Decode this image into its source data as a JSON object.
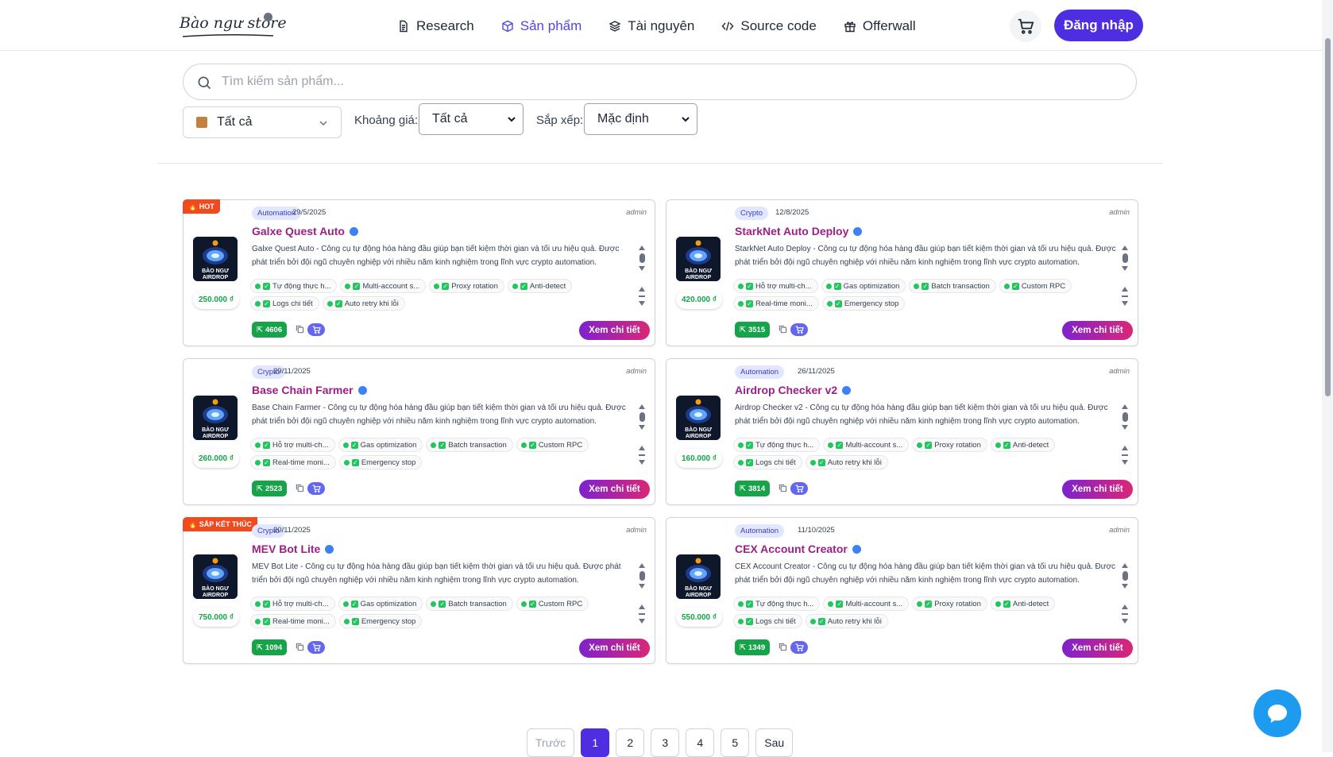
{
  "brand": {
    "logo_text": "Bào ngư store"
  },
  "nav": {
    "items": [
      {
        "label": "Research",
        "icon": "document-icon"
      },
      {
        "label": "Sản phẩm",
        "icon": "cube-icon",
        "active": true
      },
      {
        "label": "Tài nguyên",
        "icon": "layers-icon"
      },
      {
        "label": "Source code",
        "icon": "code-icon"
      },
      {
        "label": "Offerwall",
        "icon": "gift-icon"
      }
    ],
    "login_label": "Đăng nhập"
  },
  "search": {
    "placeholder": "Tìm kiếm sản phẩm..."
  },
  "filters": {
    "category_value": "Tất cả",
    "price_label": "Khoảng giá:",
    "price_value": "Tất cả",
    "sort_label": "Sắp xếp:",
    "sort_value": "Mặc định"
  },
  "products": [
    {
      "ribbon": "HOT",
      "category": "Automation",
      "date": "29/5/2025",
      "author": "admin",
      "title": "Galxe Quest Auto",
      "description": "Galxe Quest Auto - Công cụ tự động hóa hàng đầu giúp bạn tiết kiệm thời gian và tối ưu hiệu quả. Được phát triển bởi đội ngũ chuyên nghiệp với nhiều năm kinh nghiệm trong lĩnh vực crypto automation.",
      "price": "250.000 ₫",
      "features": [
        "Tự động thực h...",
        "Multi-account s...",
        "Proxy rotation",
        "Anti-detect",
        "Logs chi tiết",
        "Auto retry khi lỗi"
      ],
      "views": "4606",
      "detail_label": "Xem chi tiết"
    },
    {
      "ribbon": "",
      "category": "Crypto",
      "date": "12/8/2025",
      "author": "admin",
      "title": "StarkNet Auto Deploy",
      "description": "StarkNet Auto Deploy - Công cụ tự động hóa hàng đầu giúp bạn tiết kiệm thời gian và tối ưu hiệu quả. Được phát triển bởi đội ngũ chuyên nghiệp với nhiều năm kinh nghiệm trong lĩnh vực crypto automation.",
      "price": "420.000 ₫",
      "features": [
        "Hỗ trợ multi-ch...",
        "Gas optimization",
        "Batch transaction",
        "Custom RPC",
        "Real-time moni...",
        "Emergency stop"
      ],
      "views": "3515",
      "detail_label": "Xem chi tiết"
    },
    {
      "ribbon": "",
      "category": "Crypto",
      "date": "29/11/2025",
      "author": "admin",
      "title": "Base Chain Farmer",
      "description": "Base Chain Farmer - Công cụ tự động hóa hàng đầu giúp bạn tiết kiệm thời gian và tối ưu hiệu quả. Được phát triển bởi đội ngũ chuyên nghiệp với nhiều năm kinh nghiệm trong lĩnh vực crypto automation.",
      "price": "260.000 ₫",
      "features": [
        "Hỗ trợ multi-ch...",
        "Gas optimization",
        "Batch transaction",
        "Custom RPC",
        "Real-time moni...",
        "Emergency stop"
      ],
      "views": "2523",
      "detail_label": "Xem chi tiết"
    },
    {
      "ribbon": "",
      "category": "Automation",
      "date": "26/11/2025",
      "author": "admin",
      "title": "Airdrop Checker v2",
      "description": "Airdrop Checker v2 - Công cụ tự động hóa hàng đầu giúp bạn tiết kiệm thời gian và tối ưu hiệu quả. Được phát triển bởi đội ngũ chuyên nghiệp với nhiều năm kinh nghiệm trong lĩnh vực crypto automation.",
      "price": "160.000 ₫",
      "features": [
        "Tự động thực h...",
        "Multi-account s...",
        "Proxy rotation",
        "Anti-detect",
        "Logs chi tiết",
        "Auto retry khi lỗi"
      ],
      "views": "3814",
      "detail_label": "Xem chi tiết"
    },
    {
      "ribbon": "SẮP KẾT THÚC",
      "category": "Crypto",
      "date": "20/11/2025",
      "author": "admin",
      "title": "MEV Bot Lite",
      "description": "MEV Bot Lite - Công cụ tự động hóa hàng đầu giúp bạn tiết kiệm thời gian và tối ưu hiệu quả. Được phát triển bởi đội ngũ chuyên nghiệp với nhiều năm kinh nghiệm trong lĩnh vực crypto automation.",
      "price": "750.000 ₫",
      "features": [
        "Hỗ trợ multi-ch...",
        "Gas optimization",
        "Batch transaction",
        "Custom RPC",
        "Real-time moni...",
        "Emergency stop"
      ],
      "views": "1094",
      "detail_label": "Xem chi tiết"
    },
    {
      "ribbon": "",
      "category": "Automation",
      "date": "11/10/2025",
      "author": "admin",
      "title": "CEX Account Creator",
      "description": "CEX Account Creator - Công cụ tự động hóa hàng đầu giúp bạn tiết kiệm thời gian và tối ưu hiệu quả. Được phát triển bởi đội ngũ chuyên nghiệp với nhiều năm kinh nghiệm trong lĩnh vực crypto automation.",
      "price": "550.000 ₫",
      "features": [
        "Tự động thực h...",
        "Multi-account s...",
        "Proxy rotation",
        "Anti-detect",
        "Logs chi tiết",
        "Auto retry khi lỗi"
      ],
      "views": "1349",
      "detail_label": "Xem chi tiết"
    }
  ],
  "thumb_text": "BÀO NGƯ AIRDROP",
  "pagination": {
    "prev": "Trước",
    "pages": [
      "1",
      "2",
      "3",
      "4",
      "5"
    ],
    "current": "1",
    "next": "Sau"
  },
  "colors": {
    "primary": "#4f2de0",
    "title": "#9d1f85",
    "price": "#16a34a",
    "ribbon": "#f04a1e"
  }
}
